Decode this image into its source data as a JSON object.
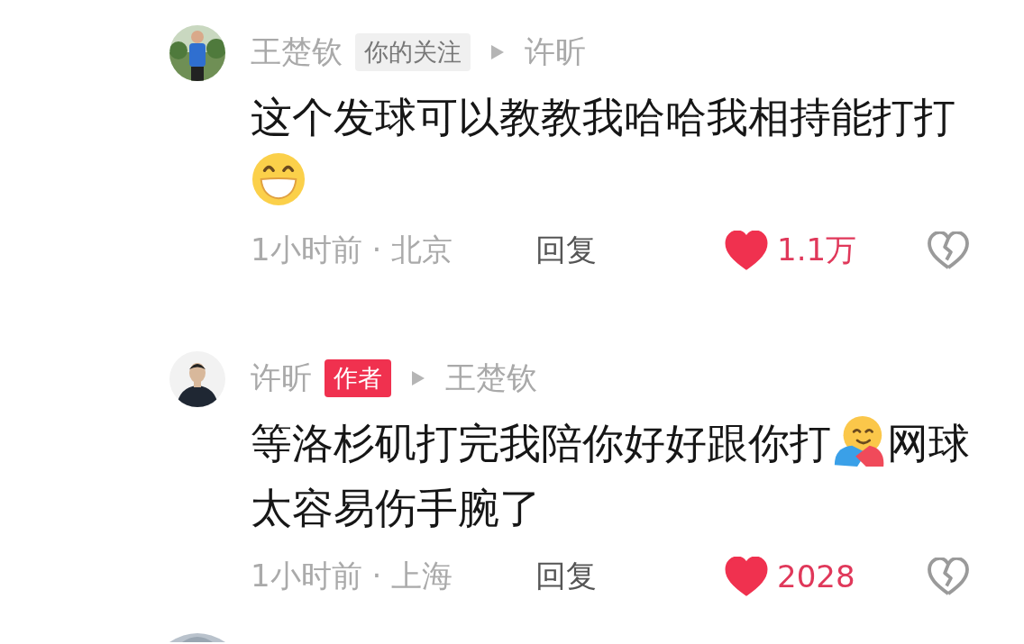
{
  "comments": [
    {
      "author": "王楚钦",
      "badge": {
        "kind": "follow",
        "label": "你的关注"
      },
      "reply_to": "许昕",
      "body": [
        {
          "kind": "text",
          "text": "这个发球可以教教我哈哈我相持能打打"
        },
        {
          "kind": "grin-emoji"
        }
      ],
      "time_place": "1小时前 · 北京",
      "reply": "回复",
      "liked": true,
      "likes": "1.1万"
    },
    {
      "author": "许昕",
      "badge": {
        "kind": "author",
        "label": "作者"
      },
      "reply_to": "王楚钦",
      "body": [
        {
          "kind": "text",
          "text": "等洛杉矶打完我陪你好好跟你打"
        },
        {
          "kind": "hug-emoji"
        },
        {
          "kind": "text",
          "text": "网球"
        },
        {
          "kind": "text",
          "text": "太容易伤手腕了"
        }
      ],
      "time_place": "1小时前 · 上海",
      "reply": "回复",
      "liked": true,
      "likes": "2028"
    }
  ]
}
